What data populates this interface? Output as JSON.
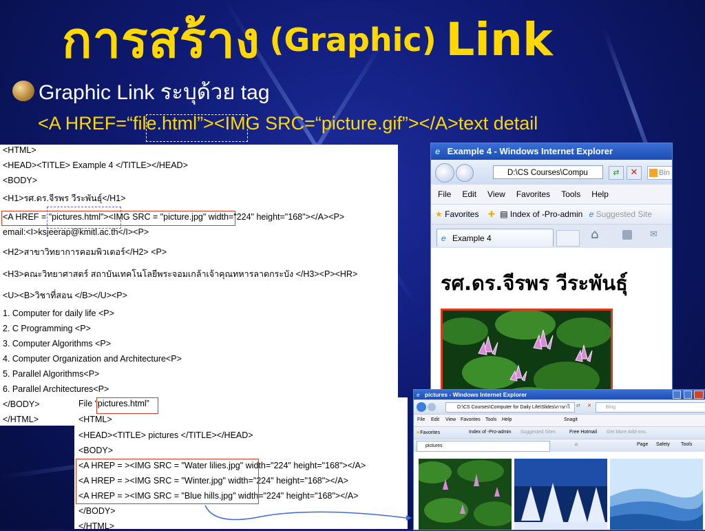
{
  "slide": {
    "title_thai": "การสร้าง",
    "title_paren": "(Graphic)",
    "title_link": "Link",
    "subtitle_en": "Graphic Link",
    "subtitle_thai": "ระบุด้วย",
    "subtitle_tag": "tag",
    "tag_line": "<A HREF=“file.html”><IMG SRC=“picture.gif”></A>text detail"
  },
  "code_panel": {
    "lines": [
      "<HTML>",
      "<HEAD><TITLE> Example 4 </TITLE></HEAD>",
      "<BODY>",
      "<H1>รศ.ดร.จีรพร วีระพันธุ์</H1>",
      "<A HREF = \"pictures.html\"><IMG SRC = \"picture.jpg\" width=\"224\" height=\"168\"></A><P>",
      "email:<I>ksjeerap@kmitl.ac.th</I><P>",
      "<H2>สาขาวิทยาการคอมพิวเตอร์</H2> <P>",
      "<H3>คณะวิทยาศาสตร์ สถาบันเทคโนโลยีพระจอมเกล้าเจ้าคุณทหารลาดกระบัง </H3><P><HR>",
      "<U><B>วิชาที่สอน </B></U><P>",
      "1. Computer for daily life <P>",
      "2. C Programming <P>",
      "3. Computer Algorithms <P>",
      "4. Computer Organization and Architecture<P>",
      "5. Parallel Algorithms<P>",
      "6. Parallel Architectures<P>",
      "</BODY>",
      "</HTML>"
    ]
  },
  "pictures_panel": {
    "file_prefix": "File “",
    "file_name": "pictures.html",
    "file_suffix": "”",
    "lines": [
      "<HTML>",
      "<HEAD><TITLE> pictures </TITLE></HEAD>",
      "<BODY>",
      "<A HREP = ><IMG SRC = \"Water lilies.jpg\" width=\"224\" height=\"168\"></A>",
      "<A HREP = ><IMG SRC = \"Winter.jpg\" width=\"224\" height=\"168\"></A>",
      "<A HREP = ><IMG SRC = \"Blue hills.jpg\" width=\"224\" height=\"168\"></A>",
      "</BODY>",
      "</HTML>"
    ]
  },
  "browser1": {
    "title": "Example 4 - Windows Internet Explorer",
    "address": "D:\\CS Courses\\Compu",
    "search_label": "Bin",
    "menu": [
      "File",
      "Edit",
      "View",
      "Favorites",
      "Tools",
      "Help"
    ],
    "favorites": "Favorites",
    "fav_link": "Index of -Pro-admin",
    "suggested": "Suggested Site",
    "tab": "Example 4",
    "heading": "รศ.ดร.จีรพร วีระพันธุ์"
  },
  "browser2": {
    "title": "pictures - Windows Internet Explorer",
    "address": "D:\\CS Courses\\Computer for Daily Life\\Slides\\ภาษาไ",
    "search_label": "Bing",
    "menu": [
      "File",
      "Edit",
      "View",
      "Favorites",
      "Tools",
      "Help"
    ],
    "snagit": "Snagit",
    "favorites": "Favorites",
    "fav_link": "Index of -Pro-admin",
    "suggested": "Suggested Sites",
    "hotmail": "Free Hotmail",
    "addons": "Get More Add-ons",
    "tab": "pictures",
    "page_menu": "Page",
    "safety_menu": "Safety",
    "tools_menu": "Tools"
  }
}
